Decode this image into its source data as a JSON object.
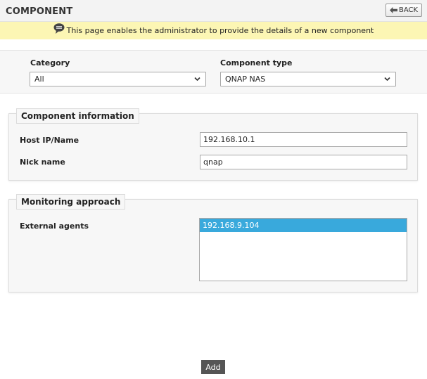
{
  "header": {
    "title": "COMPONENT",
    "back_label": "BACK"
  },
  "info": {
    "message": "This page enables the administrator to provide the details of a new component"
  },
  "filters": {
    "category_label": "Category",
    "category_value": "All",
    "component_type_label": "Component type",
    "component_type_value": "QNAP NAS"
  },
  "component_info": {
    "legend": "Component information",
    "host_label": "Host IP/Name",
    "host_value": "192.168.10.1",
    "nick_label": "Nick name",
    "nick_value": "qnap"
  },
  "monitoring": {
    "legend": "Monitoring approach",
    "agents_label": "External agents",
    "agents": [
      "192.168.9.104"
    ]
  },
  "actions": {
    "add_label": "Add"
  },
  "colors": {
    "info_bar": "#fcf6b4",
    "selected_option": "#39a9dc",
    "add_button": "#555555"
  },
  "icons": {
    "back": "back-arrow-icon",
    "info": "speech-bubble-icon",
    "dropdown": "chevron-down-icon"
  }
}
